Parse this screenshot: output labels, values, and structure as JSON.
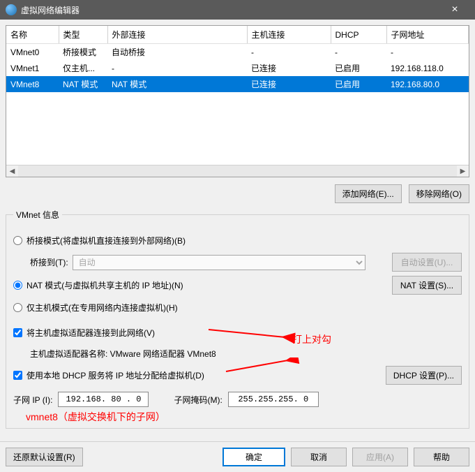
{
  "window": {
    "title": "虚拟网络编辑器",
    "close": "×"
  },
  "table": {
    "headers": [
      "名称",
      "类型",
      "外部连接",
      "主机连接",
      "DHCP",
      "子网地址"
    ],
    "rows": [
      {
        "cells": [
          "VMnet0",
          "桥接模式",
          "自动桥接",
          "-",
          "-",
          "-"
        ],
        "selected": false
      },
      {
        "cells": [
          "VMnet1",
          "仅主机...",
          "-",
          "已连接",
          "已启用",
          "192.168.118.0"
        ],
        "selected": false
      },
      {
        "cells": [
          "VMnet8",
          "NAT 模式",
          "NAT 模式",
          "已连接",
          "已启用",
          "192.168.80.0"
        ],
        "selected": true
      }
    ]
  },
  "buttons": {
    "add_network": "添加网络(E)...",
    "remove_network": "移除网络(O)",
    "auto_settings": "自动设置(U)...",
    "nat_settings": "NAT 设置(S)...",
    "dhcp_settings": "DHCP 设置(P)...",
    "restore": "还原默认设置(R)",
    "ok": "确定",
    "cancel": "取消",
    "apply": "应用(A)",
    "help": "帮助"
  },
  "fieldset": {
    "legend": "VMnet 信息",
    "bridged": "桥接模式(将虚拟机直接连接到外部网络)(B)",
    "bridge_to_label": "桥接到(T):",
    "bridge_to_value": "自动",
    "nat": "NAT 模式(与虚拟机共享主机的 IP 地址)(N)",
    "hostonly": "仅主机模式(在专用网络内连接虚拟机)(H)",
    "host_adapter": "将主机虚拟适配器连接到此网络(V)",
    "host_adapter_name": "主机虚拟适配器名称: VMware 网络适配器 VMnet8",
    "dhcp": "使用本地 DHCP 服务将 IP 地址分配给虚拟机(D)"
  },
  "ip": {
    "subnet_label": "子网 IP (I):",
    "subnet_value": "192.168. 80 . 0",
    "mask_label": "子网掩码(M):",
    "mask_value": "255.255.255. 0"
  },
  "annotations": {
    "check_note": "打上对勾",
    "subnet_note": "vmnet8（虚拟交换机下的子网）"
  }
}
